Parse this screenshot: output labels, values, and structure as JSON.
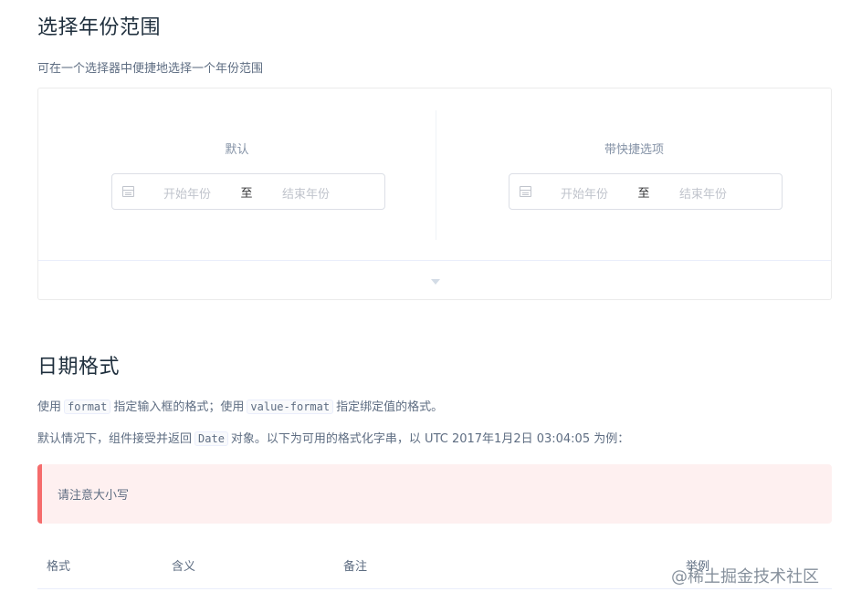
{
  "section1": {
    "title": "选择年份范围",
    "description": "可在一个选择器中便捷地选择一个年份范围",
    "demos": [
      {
        "label": "默认",
        "start_placeholder": "开始年份",
        "separator": "至",
        "end_placeholder": "结束年份"
      },
      {
        "label": "带快捷选项",
        "start_placeholder": "开始年份",
        "separator": "至",
        "end_placeholder": "结束年份"
      }
    ],
    "footer_icon": "caret-down-icon"
  },
  "section2": {
    "title": "日期格式",
    "p1": {
      "a": "使用",
      "code1": "format",
      "b": "指定输入框的格式；使用",
      "code2": "value-format",
      "c": "指定绑定值的格式。"
    },
    "p2": {
      "a": "默认情况下，组件接受并返回",
      "code": "Date",
      "b": "对象。以下为可用的格式化字串，以 UTC 2017年1月2日 03:04:05 为例："
    },
    "tip": "请注意大小写",
    "table_headers": [
      "格式",
      "含义",
      "备注",
      "举例"
    ]
  },
  "watermark": "@稀土掘金技术社区",
  "colors": {
    "danger": "#f56c6c",
    "tip_bg": "#fef0f0",
    "border": "#dcdfe6"
  }
}
